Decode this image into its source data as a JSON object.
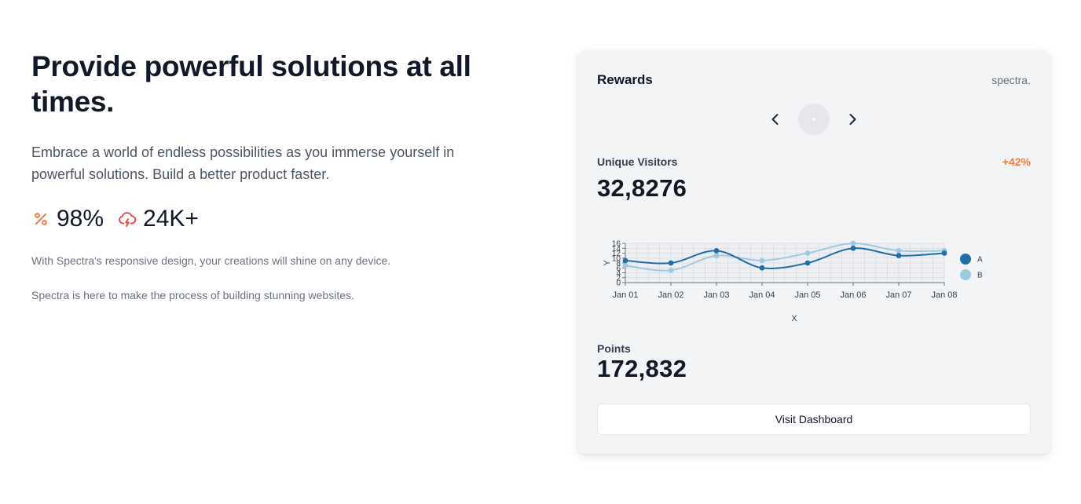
{
  "hero": {
    "headline": "Provide powerful solutions at all times.",
    "lead": "Embrace a world of endless possibilities as you immerse yourself in powerful solutions. Build a better product faster.",
    "stats": [
      {
        "icon": "percent-icon",
        "value": "98%"
      },
      {
        "icon": "cloud-lightning-icon",
        "value": "24K+"
      }
    ],
    "notes": [
      "With Spectra's responsive design, your creations will shine on any device.",
      "Spectra is here to make the process of building stunning websites."
    ]
  },
  "card": {
    "title": "Rewards",
    "brand": "spectra.",
    "carousel": {
      "prev_icon": "chevron-left-icon",
      "next_icon": "chevron-right-icon"
    },
    "unique_visitors": {
      "label": "Unique Visitors",
      "value": "32,8276",
      "change": "+42%"
    },
    "points": {
      "label": "Points",
      "value": "172,832"
    },
    "cta_label": "Visit Dashboard"
  },
  "colors": {
    "accent_orange": "#f07b3f",
    "accent_red": "#ef4444",
    "series_a": "#1f6fa6",
    "series_b": "#9ecae1"
  },
  "chart_data": {
    "type": "line",
    "x": [
      "Jan 01",
      "Jan 02",
      "Jan 03",
      "Jan 04",
      "Jan 05",
      "Jan 06",
      "Jan 07",
      "Jan 08"
    ],
    "series": [
      {
        "name": "A",
        "values": [
          9,
          8,
          13,
          6,
          8,
          14,
          11,
          12
        ]
      },
      {
        "name": "B",
        "values": [
          7,
          5,
          11,
          9,
          12,
          16,
          13,
          13
        ]
      }
    ],
    "xlabel": "X",
    "ylabel": "Y",
    "yticks": [
      "0",
      "2",
      "4",
      "6",
      "8",
      "10",
      "12",
      "14",
      "16"
    ],
    "ylim": [
      0,
      16
    ],
    "grid": true,
    "legend": "right",
    "curve": "smooth"
  }
}
